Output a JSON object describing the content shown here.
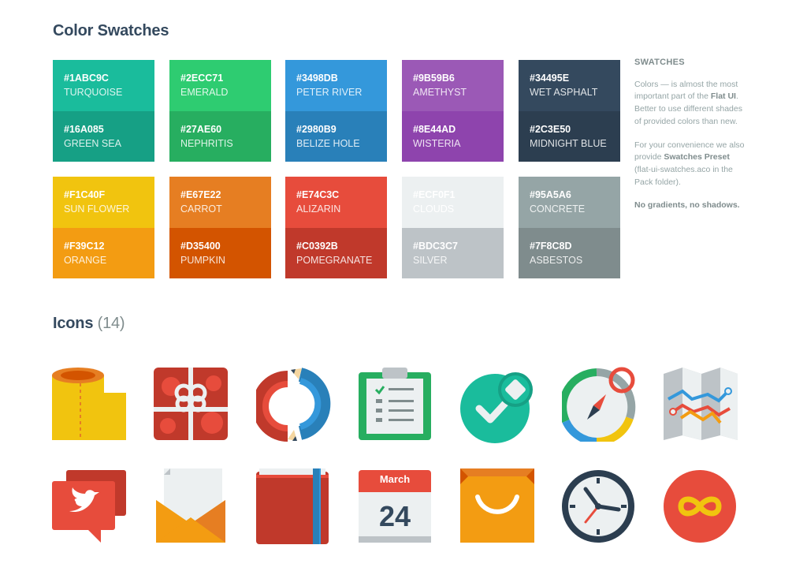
{
  "page": {
    "swatches_title": "Color Swatches",
    "icons_title": "Icons",
    "icons_count": "(14)"
  },
  "swatches": [
    {
      "top": {
        "hex": "#1ABC9C",
        "name": "TURQUOISE",
        "color": "#1abc9c"
      },
      "bottom": {
        "hex": "#16A085",
        "name": "GREEN SEA",
        "color": "#16a085"
      }
    },
    {
      "top": {
        "hex": "#2ECC71",
        "name": "EMERALD",
        "color": "#2ecc71"
      },
      "bottom": {
        "hex": "#27AE60",
        "name": "NEPHRITIS",
        "color": "#27ae60"
      }
    },
    {
      "top": {
        "hex": "#3498DB",
        "name": "PETER RIVER",
        "color": "#3498db"
      },
      "bottom": {
        "hex": "#2980B9",
        "name": "BELIZE HOLE",
        "color": "#2980b9"
      }
    },
    {
      "top": {
        "hex": "#9B59B6",
        "name": "AMETHYST",
        "color": "#9b59b6"
      },
      "bottom": {
        "hex": "#8E44AD",
        "name": "WISTERIA",
        "color": "#8e44ad"
      }
    },
    {
      "top": {
        "hex": "#34495E",
        "name": "WET ASPHALT",
        "color": "#34495e"
      },
      "bottom": {
        "hex": "#2C3E50",
        "name": "MIDNIGHT BLUE",
        "color": "#2c3e50"
      }
    },
    {
      "top": {
        "hex": "#F1C40F",
        "name": "SUN FLOWER",
        "color": "#f1c40f"
      },
      "bottom": {
        "hex": "#F39C12",
        "name": "ORANGE",
        "color": "#f39c12"
      }
    },
    {
      "top": {
        "hex": "#E67E22",
        "name": "CARROT",
        "color": "#e67e22"
      },
      "bottom": {
        "hex": "#D35400",
        "name": "PUMPKIN",
        "color": "#d35400"
      }
    },
    {
      "top": {
        "hex": "#E74C3C",
        "name": "ALIZARIN",
        "color": "#e74c3c"
      },
      "bottom": {
        "hex": "#C0392B",
        "name": "POMEGRANATE",
        "color": "#c0392b"
      }
    },
    {
      "top": {
        "hex": "#ECF0F1",
        "name": "CLOUDS",
        "color": "#ecf0f1"
      },
      "bottom": {
        "hex": "#BDC3C7",
        "name": "SILVER",
        "color": "#bdc3c7"
      }
    },
    {
      "top": {
        "hex": "#95A5A6",
        "name": "CONCRETE",
        "color": "#95a5a6"
      },
      "bottom": {
        "hex": "#7F8C8D",
        "name": "ASBESTOS",
        "color": "#7f8c8d"
      }
    }
  ],
  "sidebar": {
    "title": "SWATCHES",
    "p1_a": "Colors — is almost the most important part of the ",
    "p1_b": "Flat UI",
    "p1_c": ". Better to use different shades of provided colors than new.",
    "p2_a": "For your convenience we also provide ",
    "p2_b": "Swatches Preset",
    "p2_c": " (flat-ui-swatches.aco in the Pack folder).",
    "p3": "No gradients, no shadows."
  },
  "icons": [
    {
      "name": "toilet-paper-icon"
    },
    {
      "name": "gift-icon"
    },
    {
      "name": "pencils-icon"
    },
    {
      "name": "clipboard-icon"
    },
    {
      "name": "checkmark-icon"
    },
    {
      "name": "compass-icon"
    },
    {
      "name": "map-icon"
    },
    {
      "name": "chat-bubble-icon"
    },
    {
      "name": "mail-icon"
    },
    {
      "name": "book-icon"
    },
    {
      "name": "calendar-icon"
    },
    {
      "name": "shopping-bag-icon"
    },
    {
      "name": "clock-icon"
    },
    {
      "name": "infinity-icon"
    }
  ],
  "calendar": {
    "month": "March",
    "day": "24"
  }
}
